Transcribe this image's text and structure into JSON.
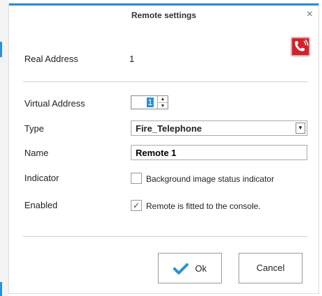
{
  "dialog": {
    "title": "Remote settings",
    "close_glyph": "×"
  },
  "real_address": {
    "label": "Real Address",
    "value": "1",
    "icon": "fire-telephone-icon",
    "icon_color": "#d3212b"
  },
  "virtual_address": {
    "label": "Virtual Address",
    "value": "1"
  },
  "type": {
    "label": "Type",
    "value": "Fire_Telephone"
  },
  "name": {
    "label": "Name",
    "value": "Remote 1"
  },
  "indicator": {
    "label": "Indicator",
    "checkbox_label": "Background image status indicator",
    "checked": false
  },
  "enabled": {
    "label": "Enabled",
    "checkbox_label": "Remote is fitted to the console.",
    "checked": true,
    "check_glyph": "✓"
  },
  "buttons": {
    "ok_label": "Ok",
    "cancel_label": "Cancel",
    "ok_check_color": "#2a8fd6"
  },
  "accent_color": "#2a8fd6"
}
